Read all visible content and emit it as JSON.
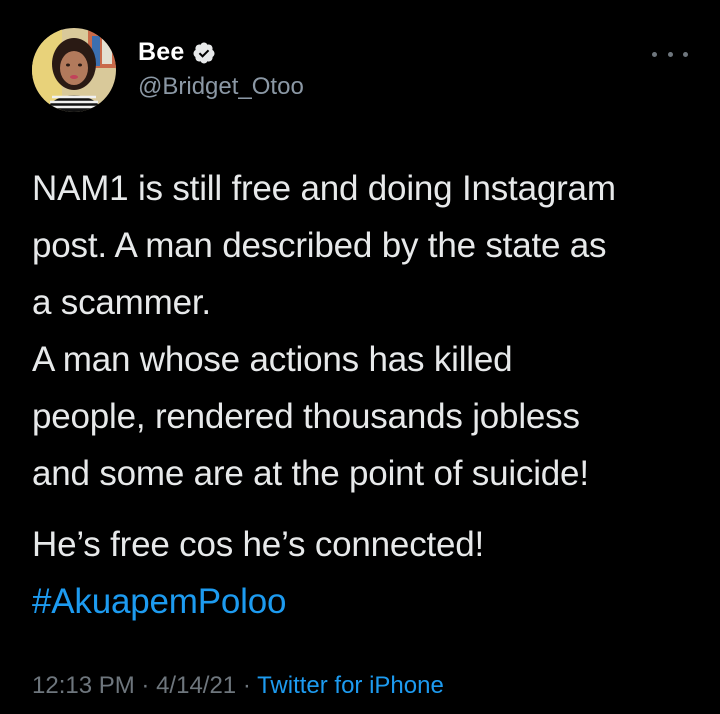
{
  "tweet": {
    "author": {
      "display_name": "Bee",
      "handle": "@Bridget_Otoo",
      "verified": true
    },
    "more_icon": "more-horizontal-icon",
    "body": {
      "line1": "NAM1 is still free and doing Instagram",
      "line2": "post. A man described by the state as",
      "line3": "a scammer.",
      "line4": "A man whose actions has killed",
      "line5": "people, rendered thousands jobless",
      "line6": "and some are at the point of suicide!",
      "line7": "He’s free cos he’s connected!",
      "hashtag": "#AkuapemPoloo"
    },
    "meta": {
      "time": "12:13 PM",
      "separator": "·",
      "date": "4/14/21",
      "source": "Twitter for iPhone"
    }
  },
  "colors": {
    "background": "#000000",
    "text": "#e7e9ea",
    "secondary_text": "#8b98a5",
    "accent": "#1d9bf0"
  }
}
